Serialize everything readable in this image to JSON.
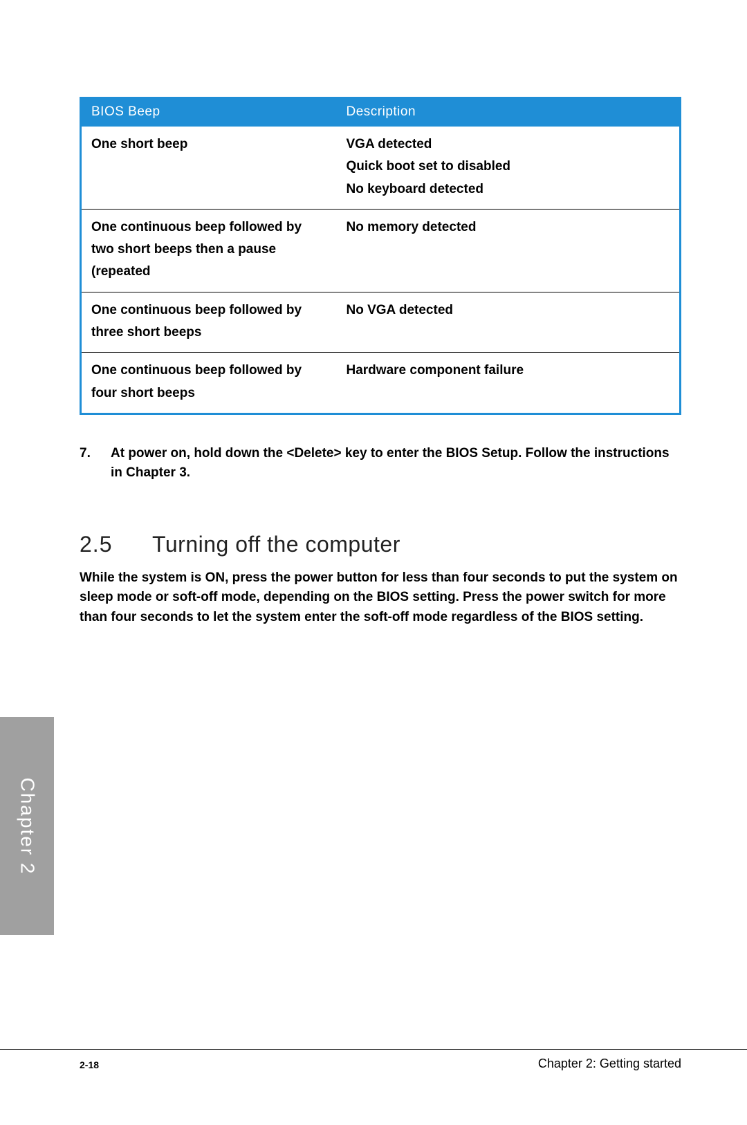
{
  "table": {
    "headers": {
      "col1": "BIOS Beep",
      "col2": "Description"
    },
    "rows": [
      {
        "beep": "One short beep",
        "desc": "VGA detected\nQuick boot set to disabled\nNo keyboard detected"
      },
      {
        "beep": "One continuous beep followed by two short beeps then a pause (repeated",
        "desc": "No memory detected"
      },
      {
        "beep": "One continuous beep followed by three short beeps",
        "desc": "No VGA detected"
      },
      {
        "beep": "One continuous beep followed by four short beeps",
        "desc": "Hardware component failure"
      }
    ]
  },
  "step": {
    "num": "7.",
    "text": "At power on, hold down the <Delete> key to enter the BIOS Setup. Follow the instructions in Chapter 3."
  },
  "section": {
    "num": "2.5",
    "title": "Turning off the computer",
    "body": "While the system is ON, press the power button for less than four seconds to put the system on sleep mode or soft-off mode, depending on the BIOS setting. Press the power switch for more than four seconds to let the system enter the soft-off mode regardless of the BIOS setting."
  },
  "sidetab": "Chapter 2",
  "footer": {
    "left": "2-18",
    "right": "Chapter 2: Getting started"
  }
}
